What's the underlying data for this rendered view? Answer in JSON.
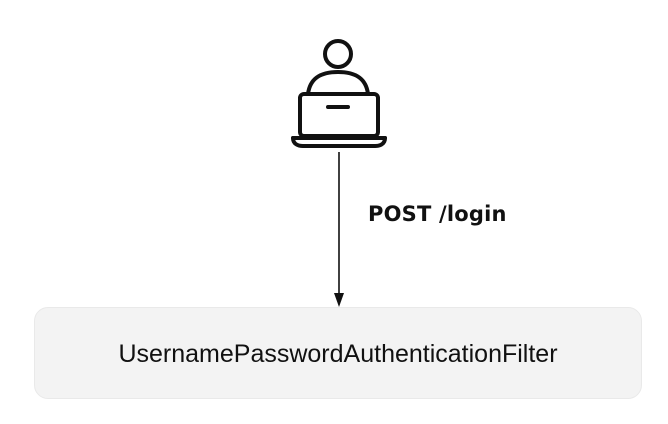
{
  "icons": {
    "user": "user-laptop-icon"
  },
  "request": {
    "label": "POST /login"
  },
  "filter": {
    "label": "UsernamePasswordAuthenticationFilter"
  },
  "colors": {
    "stroke": "#111111",
    "box_fill": "#f3f3f3",
    "box_border": "#e9e9e9",
    "background": "#ffffff"
  }
}
